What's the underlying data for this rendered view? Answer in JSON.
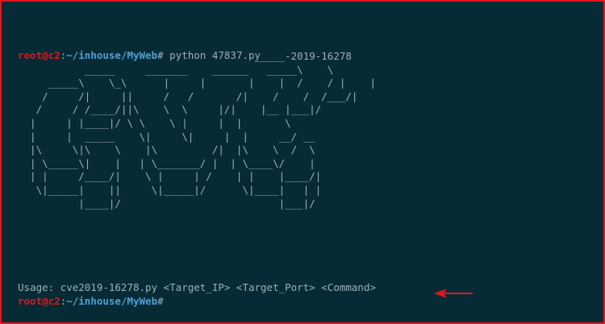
{
  "terminal": {
    "prompt_1": {
      "user_host": "root@c2",
      "colon": ":",
      "path": "~/inhouse/MyWeb",
      "sign": "#",
      "command": "python 47837.py"
    },
    "banner_text": "                                       _____-2019-16278\n           _____     _______    ______   _____\\    \\\n     _____\\    \\_\\      |     |       |    |  /    / |    |\n    /     /|     ||     /   /       /|    /    /  /___/|\n   /     / /____/||\\    \\  \\     |/|    |__ |___|/\n  |     | |____|/ \\ \\    \\ |     |  |       \\\n  |     |  _____    \\|     \\|     |  |     __/ __\n  |\\     \\|\\    \\    |\\         /|  |\\    \\  /  \\\n  | \\_____\\|    |   | \\_______/ |  | \\____\\/    |\n  | |     /____/|    \\ |     | /    | |    |____/|\n   \\|_____|    ||     \\|_____|/      \\|____|   | |\n          |____|/                          |___|/",
    "usage": "Usage: cve2019-16278.py <Target_IP> <Target_Port> <Command>",
    "prompt_2": {
      "user_host": "root@c2",
      "colon": ":",
      "path": "~/inhouse/MyWeb",
      "sign": "#"
    }
  },
  "annotation": {
    "arrow_icon": "arrow-left-icon",
    "arrow_color": "#e1161d"
  },
  "colors": {
    "background": "#062b35",
    "frame_border": "#e1161d",
    "prompt_user": "#e1161d",
    "prompt_path": "#4fa0d8",
    "text": "#9db1b6"
  }
}
